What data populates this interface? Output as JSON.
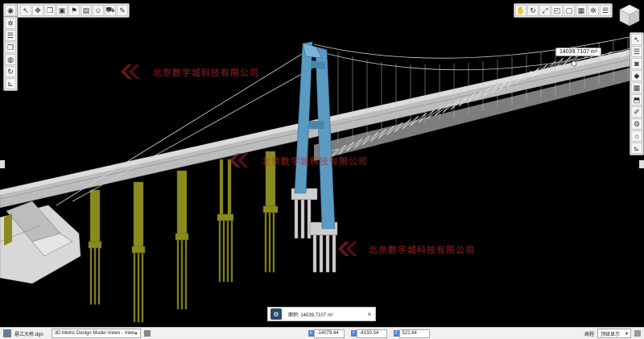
{
  "toolbar_top_left": {
    "icons": [
      "home-icon",
      "select-arrow-icon",
      "move-icon",
      "copy-icon",
      "cube-icon",
      "flag-icon",
      "image-icon",
      "person-icon",
      "car-icon",
      "pen-icon"
    ]
  },
  "toolbar_top_right": {
    "icons": [
      "hand-icon",
      "rotate-icon",
      "fit-view-icon",
      "zoom-window-icon",
      "frame-icon",
      "lock-icon",
      "gear-icon",
      "layers-icon"
    ]
  },
  "toolbar_left": {
    "icons": [
      "compass-icon",
      "gear-icon",
      "layers-icon",
      "copy-icon",
      "globe-icon",
      "refresh-icon",
      "ruler-icon"
    ]
  },
  "toolbar_right": {
    "icons": [
      "cursor-icon",
      "list-icon",
      "camera-icon",
      "marker-icon",
      "grid-icon",
      "tag-icon",
      "paint-icon",
      "settings-icon",
      "sun-icon",
      "ruler-icon"
    ]
  },
  "measure": {
    "label": "14039.7107 m²"
  },
  "message": {
    "text": "面积: 14039.7107 m²",
    "close": "×"
  },
  "watermark": {
    "text": "北京数字城科技有限公司"
  },
  "statusbar": {
    "file": "悬江大桥.dgn",
    "view": "3D Metric Design Model Views - View",
    "x_label": "X",
    "x": "-14079.44",
    "y_label": "Y",
    "y": "-4150.34",
    "z_label": "Z",
    "z": "522.64",
    "mode_label": "高程",
    "mode_value": "顶级显示"
  },
  "colors": {
    "tower": "#5b9bc2",
    "pier": "#8a8a20",
    "deck": "#c8c8c8"
  }
}
